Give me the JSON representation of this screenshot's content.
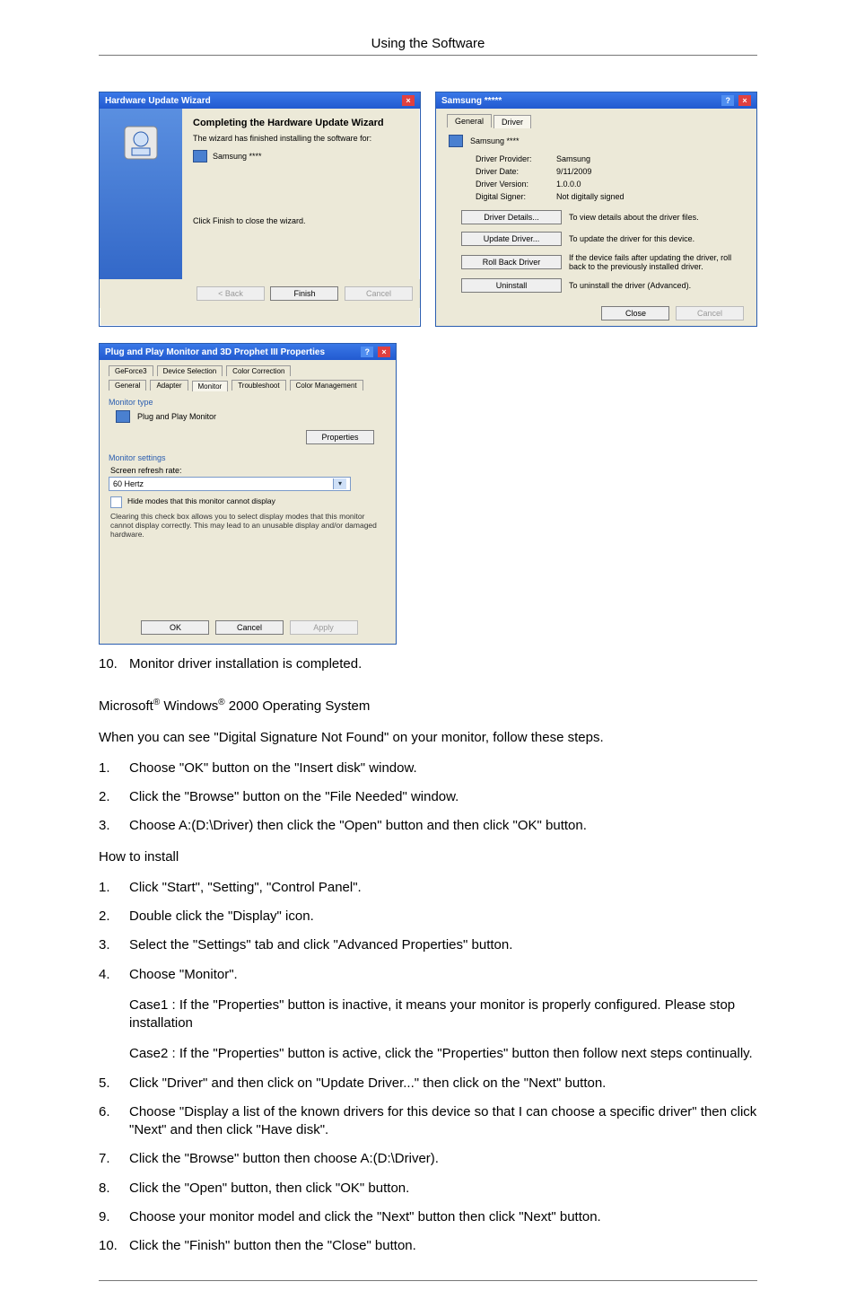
{
  "header": {
    "title": "Using the Software"
  },
  "wizard": {
    "title": "Hardware Update Wizard",
    "heading": "Completing the Hardware Update Wizard",
    "sub": "The wizard has finished installing the software for:",
    "device": "Samsung ****",
    "footnote": "Click Finish to close the wizard.",
    "back": "< Back",
    "finish": "Finish",
    "cancel": "Cancel"
  },
  "driver": {
    "title": "Samsung *****",
    "tab_general": "General",
    "tab_driver": "Driver",
    "device": "Samsung ****",
    "rows": {
      "provider_k": "Driver Provider:",
      "provider_v": "Samsung",
      "date_k": "Driver Date:",
      "date_v": "9/11/2009",
      "version_k": "Driver Version:",
      "version_v": "1.0.0.0",
      "signer_k": "Digital Signer:",
      "signer_v": "Not digitally signed"
    },
    "btn_details": "Driver Details...",
    "desc_details": "To view details about the driver files.",
    "btn_update": "Update Driver...",
    "desc_update": "To update the driver for this device.",
    "btn_rollback": "Roll Back Driver",
    "desc_rollback": "If the device fails after updating the driver, roll back to the previously installed driver.",
    "btn_uninstall": "Uninstall",
    "desc_uninstall": "To uninstall the driver (Advanced).",
    "close": "Close",
    "cancel": "Cancel"
  },
  "pnp": {
    "title": "Plug and Play Monitor and 3D Prophet III Properties",
    "tabs": {
      "geforce": "GeForce3",
      "devsel": "Device Selection",
      "colorcorr": "Color Correction",
      "general": "General",
      "adapter": "Adapter",
      "monitor": "Monitor",
      "trouble": "Troubleshoot",
      "colormgmt": "Color Management"
    },
    "grp_type": "Monitor type",
    "type_value": "Plug and Play Monitor",
    "properties": "Properties",
    "grp_settings": "Monitor settings",
    "refresh_label": "Screen refresh rate:",
    "refresh_value": "60 Hertz",
    "hide": "Hide modes that this monitor cannot display",
    "note": "Clearing this check box allows you to select display modes that this monitor cannot display correctly. This may lead to an unusable display and/or damaged hardware.",
    "ok": "OK",
    "cancel": "Cancel",
    "apply": "Apply"
  },
  "body": {
    "li10": "Monitor driver installation is completed.",
    "osline_a": "Microsoft",
    "osline_b": " Windows",
    "osline_c": " 2000 Operating System",
    "leadin": "When you can see \"Digital Signature Not Found\" on your monitor, follow these steps.",
    "s1": "Choose \"OK\" button on the \"Insert disk\" window.",
    "s2": "Click the \"Browse\" button on the \"File Needed\" window.",
    "s3": "Choose A:(D:\\Driver) then click the \"Open\" button and then click \"OK\" button.",
    "howto": "How to install",
    "h1": "Click \"Start\", \"Setting\", \"Control Panel\".",
    "h2": "Double click the \"Display\" icon.",
    "h3": "Select the \"Settings\" tab and click \"Advanced Properties\" button.",
    "h4": "Choose \"Monitor\".",
    "h4c1": "Case1 : If the \"Properties\" button is inactive, it means your monitor is properly configured. Please stop installation",
    "h4c2": "Case2 : If the \"Properties\" button is active, click the \"Properties\" button then follow next steps continually.",
    "h5": "Click \"Driver\" and then click on \"Update Driver...\" then click on the \"Next\" button.",
    "h6": "Choose \"Display a list of the known drivers for this device so that I can choose a specific driver\" then click \"Next\" and then click \"Have disk\".",
    "h7": "Click the \"Browse\" button then choose A:(D:\\Driver).",
    "h8": "Click the \"Open\" button, then click \"OK\" button.",
    "h9": "Choose your monitor model and click the \"Next\" button then click \"Next\" button.",
    "h10": "Click the \"Finish\" button then the \"Close\" button."
  }
}
